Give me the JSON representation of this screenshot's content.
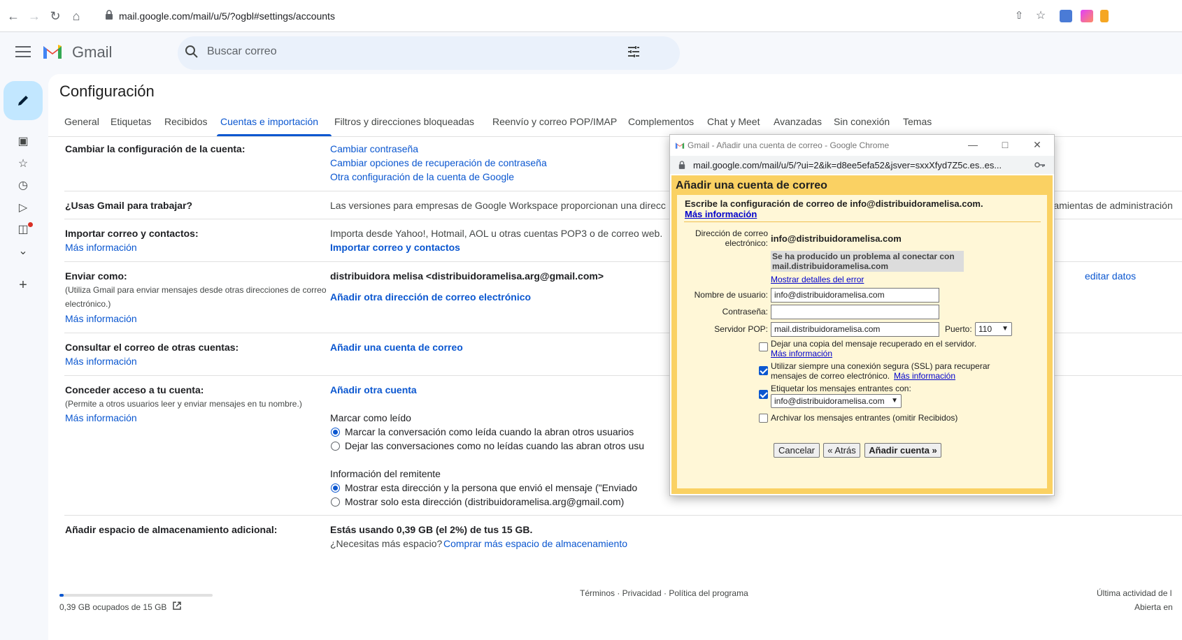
{
  "browser": {
    "url": "mail.google.com/mail/u/5/?ogbl#settings/accounts"
  },
  "header": {
    "logo_text": "Gmail",
    "search_placeholder": "Buscar correo"
  },
  "page": {
    "title": "Configuración",
    "tabs": [
      {
        "label": "General"
      },
      {
        "label": "Etiquetas"
      },
      {
        "label": "Recibidos"
      },
      {
        "label": "Cuentas e importación"
      },
      {
        "label": "Filtros y direcciones bloqueadas"
      },
      {
        "label": "Reenvío y correo POP/IMAP"
      },
      {
        "label": "Complementos"
      },
      {
        "label": "Chat y Meet"
      },
      {
        "label": "Avanzadas"
      },
      {
        "label": "Sin conexión"
      },
      {
        "label": "Temas"
      }
    ]
  },
  "settings": {
    "account": {
      "label": "Cambiar la configuración de la cuenta:",
      "links": [
        "Cambiar contraseña",
        "Cambiar opciones de recuperación de contraseña",
        "Otra configuración de la cuenta de Google"
      ]
    },
    "work": {
      "label": "¿Usas Gmail para trabajar?",
      "text": "Las versiones para empresas de Google Workspace proporcionan una direcc",
      "text_right": "rramientas de administración"
    },
    "import": {
      "label": "Importar correo y contactos:",
      "more": "Más información",
      "text": "Importa desde Yahoo!, Hotmail, AOL u otras cuentas POP3 o de correo web.",
      "action": "Importar correo y contactos"
    },
    "send_as": {
      "label": "Enviar como:",
      "sub": "(Utiliza Gmail para enviar mensajes desde otras direcciones de correo electrónico.)",
      "more": "Más información",
      "address": "distribuidora melisa <distribuidoramelisa.arg@gmail.com>",
      "action": "Añadir otra dirección de correo electrónico",
      "edit": "editar datos"
    },
    "check_mail": {
      "label": "Consultar el correo de otras cuentas:",
      "more": "Más información",
      "action": "Añadir una cuenta de correo"
    },
    "grant": {
      "label": "Conceder acceso a tu cuenta:",
      "sub": "(Permite a otros usuarios leer y enviar mensajes en tu nombre.)",
      "more": "Más información",
      "action": "Añadir otra cuenta",
      "mark_read_title": "Marcar como leído",
      "mark_read_opt1": "Marcar la conversación como leída cuando la abran otros usuarios",
      "mark_read_opt2": "Dejar las conversaciones como no leídas cuando las abran otros usu",
      "sender_title": "Información del remitente",
      "sender_opt1": "Mostrar esta dirección y la persona que envió el mensaje (\"Enviado",
      "sender_opt2": "Mostrar solo esta dirección (distribuidoramelisa.arg@gmail.com)"
    },
    "storage": {
      "label": "Añadir espacio de almacenamiento adicional:",
      "usage": "Estás usando 0,39 GB (el 2%) de tus 15 GB.",
      "question": "¿Necesitas más espacio?",
      "buy": "Comprar más espacio de almacenamiento"
    }
  },
  "footer": {
    "storage_text": "0,39 GB ocupados de 15 GB",
    "storage_fraction": 0.026,
    "links": "Términos · Privacidad · Política del programa",
    "activity": "Última actividad de l",
    "open_in": "Abierta en"
  },
  "popup": {
    "window_title": "Gmail - Añadir una cuenta de correo - Google Chrome",
    "url": "mail.google.com/mail/u/5/?ui=2&ik=d8ee5efa52&jsver=sxxXfyd7Z5c.es..es...",
    "heading": "Añadir una cuenta de correo",
    "intro": "Escribe la configuración de correo de info@distribuidoramelisa.com.",
    "intro_more": "Más información",
    "email_label_1": "Dirección de correo",
    "email_label_2": "electrónico:",
    "email_value": "info@distribuidoramelisa.com",
    "error_1": "Se ha producido un problema al conectar con",
    "error_2": "mail.distribuidoramelisa.com",
    "error_details": "Mostrar detalles del error",
    "username_label": "Nombre de usuario:",
    "username_value": "info@distribuidoramelisa.com",
    "password_label": "Contraseña:",
    "password_value": "",
    "pop_label": "Servidor POP:",
    "pop_value": "mail.distribuidoramelisa.com",
    "port_label": "Puerto:",
    "port_value": "110",
    "opt_copy": "Dejar una copia del mensaje recuperado en el servidor.",
    "opt_copy_more": "Más información",
    "opt_ssl_1": "Utilizar siempre una conexión segura (SSL) para recuperar",
    "opt_ssl_2": "mensajes de correo electrónico.",
    "opt_ssl_more": "Más información",
    "opt_label": "Etiquetar los mensajes entrantes con:",
    "opt_label_value": "info@distribuidoramelisa.com",
    "opt_archive": "Archivar los mensajes entrantes (omitir Recibidos)",
    "btn_cancel": "Cancelar",
    "btn_back": "« Atrás",
    "btn_add": "Añadir cuenta »"
  },
  "colors": {
    "accent": "#0b57d0",
    "dialog_border": "#fad163",
    "dialog_bg": "#fff7d7"
  }
}
